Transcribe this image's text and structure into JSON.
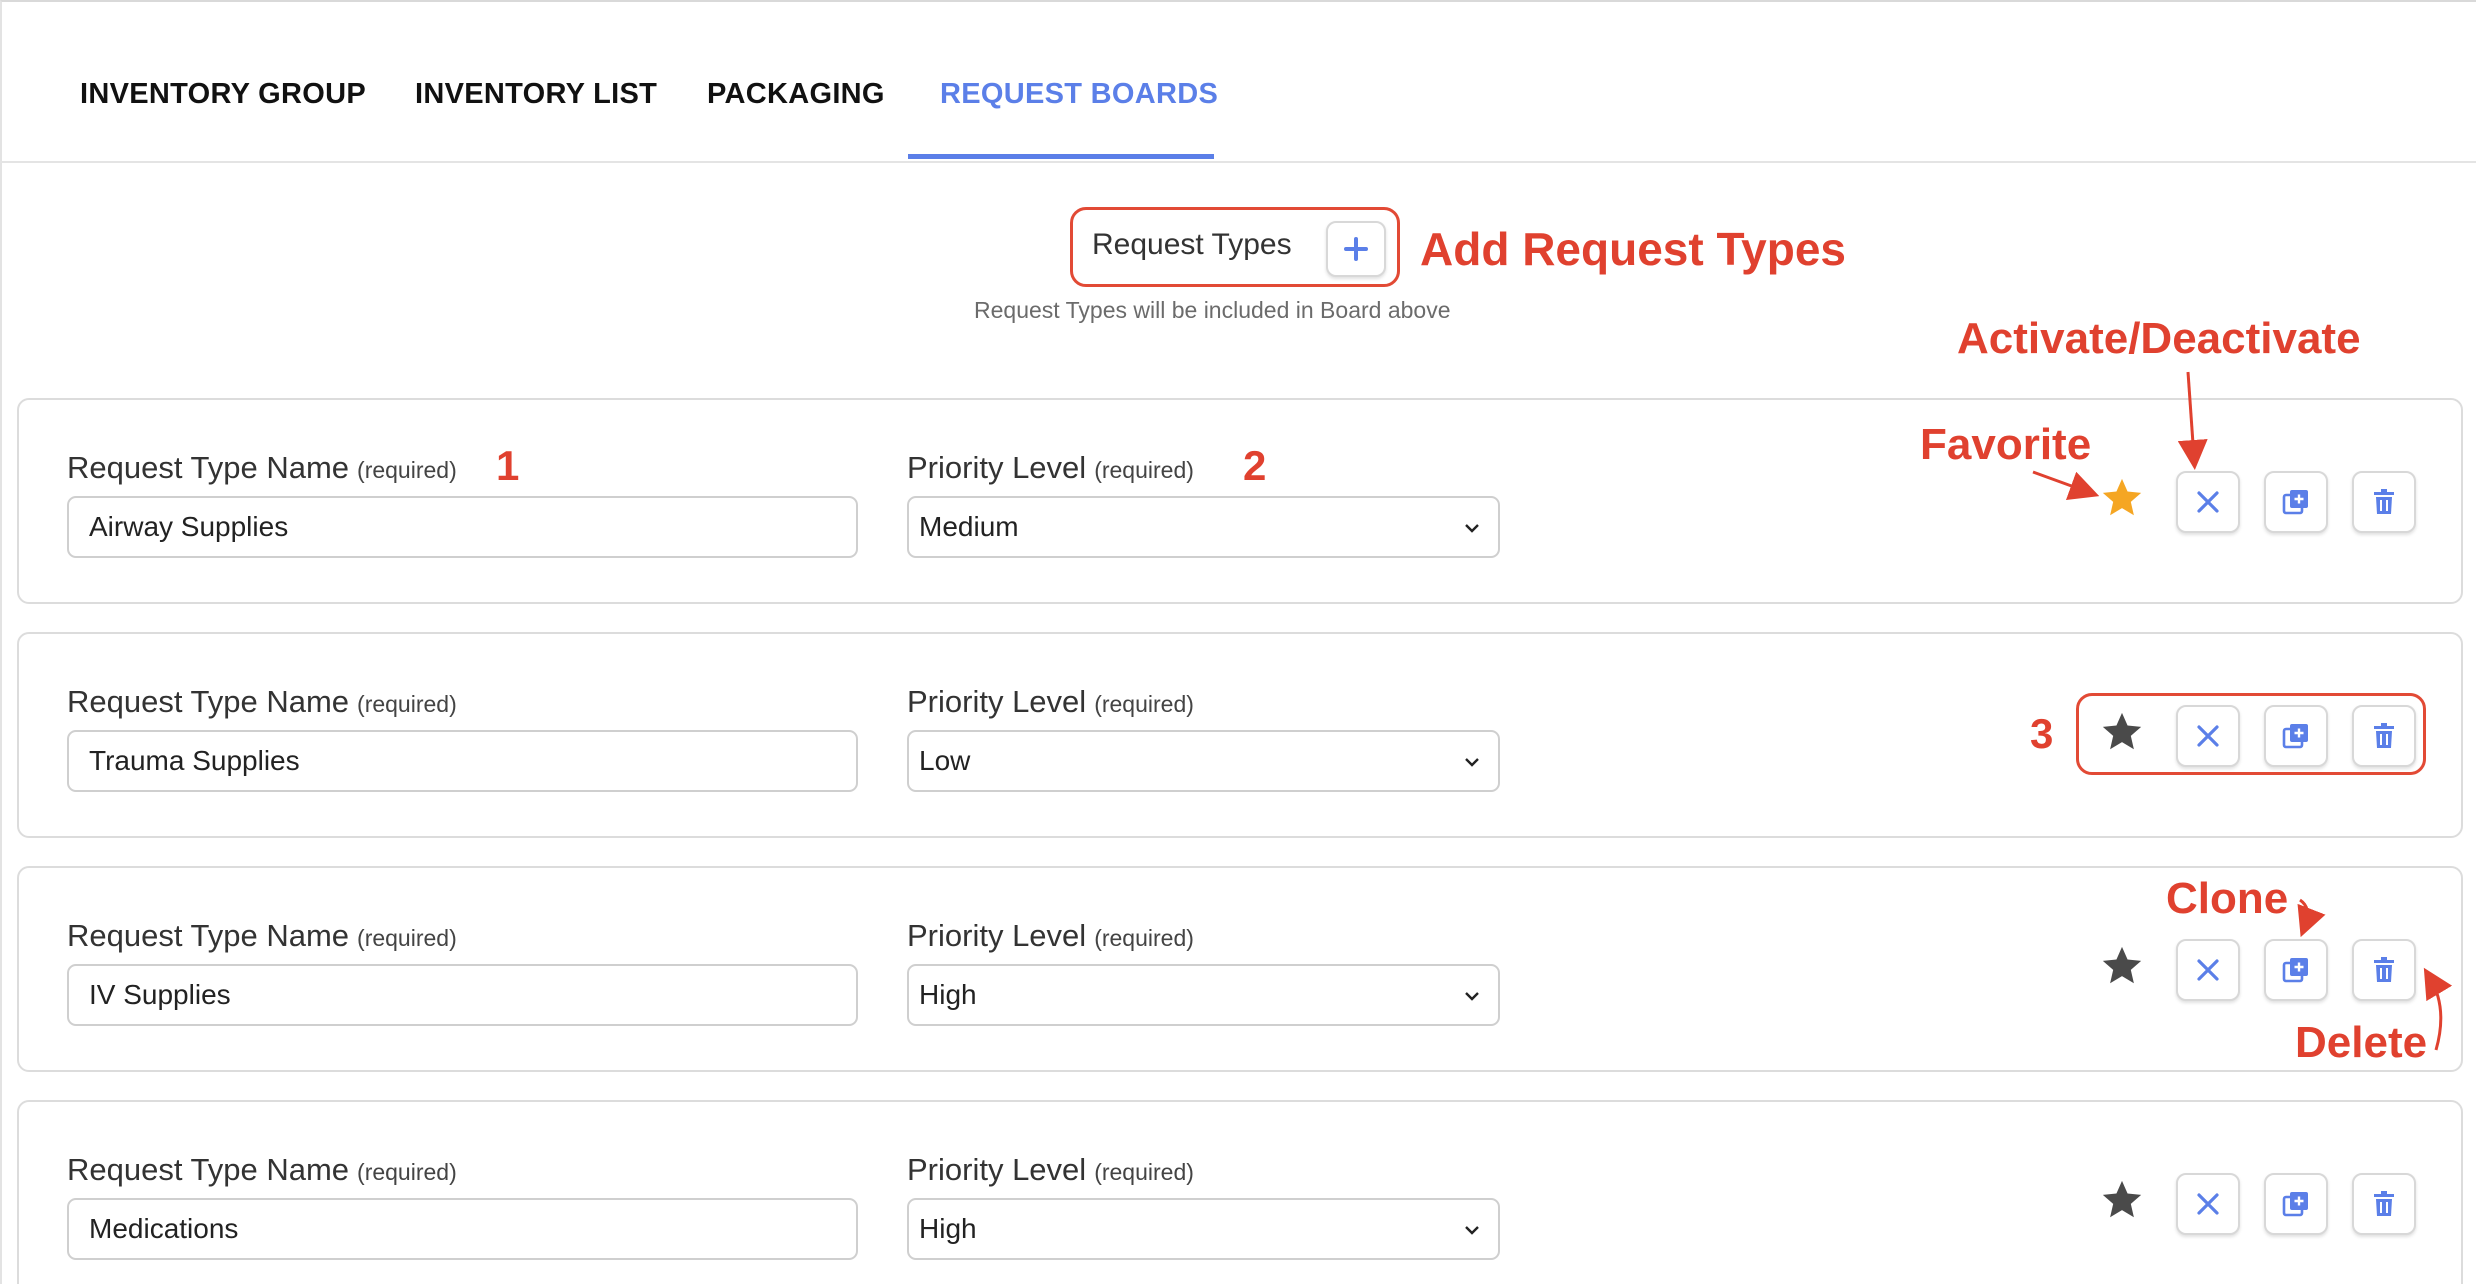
{
  "tabs": [
    {
      "label": "INVENTORY GROUP",
      "active": false
    },
    {
      "label": "INVENTORY LIST",
      "active": false
    },
    {
      "label": "PACKAGING",
      "active": false
    },
    {
      "label": "REQUEST BOARDS",
      "active": true
    }
  ],
  "request_types_header": {
    "label": "Request Types",
    "add_icon": "plus-icon",
    "hint": "Request Types will be included in Board above"
  },
  "field_labels": {
    "name": "Request Type Name",
    "priority": "Priority Level",
    "required": "(required)"
  },
  "request_types": [
    {
      "name": "Airway Supplies",
      "priority": "Medium",
      "favorite": true
    },
    {
      "name": "Trauma Supplies",
      "priority": "Low",
      "favorite": false
    },
    {
      "name": "IV Supplies",
      "priority": "High",
      "favorite": false
    },
    {
      "name": "Medications",
      "priority": "High",
      "favorite": false
    }
  ],
  "icons": {
    "favorite": "star-icon",
    "deactivate": "close-icon",
    "clone": "clone-icon",
    "delete": "trash-icon",
    "dropdown": "chevron-down-icon"
  },
  "annotations": {
    "add_request_types": "Add Request Types",
    "activate_deactivate": "Activate/Deactivate",
    "favorite": "Favorite",
    "clone": "Clone",
    "delete": "Delete",
    "marker_1": "1",
    "marker_2": "2",
    "marker_3": "3"
  },
  "colors": {
    "accent": "#5b7fe8",
    "annotation": "#e0412f",
    "favorite_star": "#f5a623",
    "star_inactive": "#4a4a4a"
  }
}
